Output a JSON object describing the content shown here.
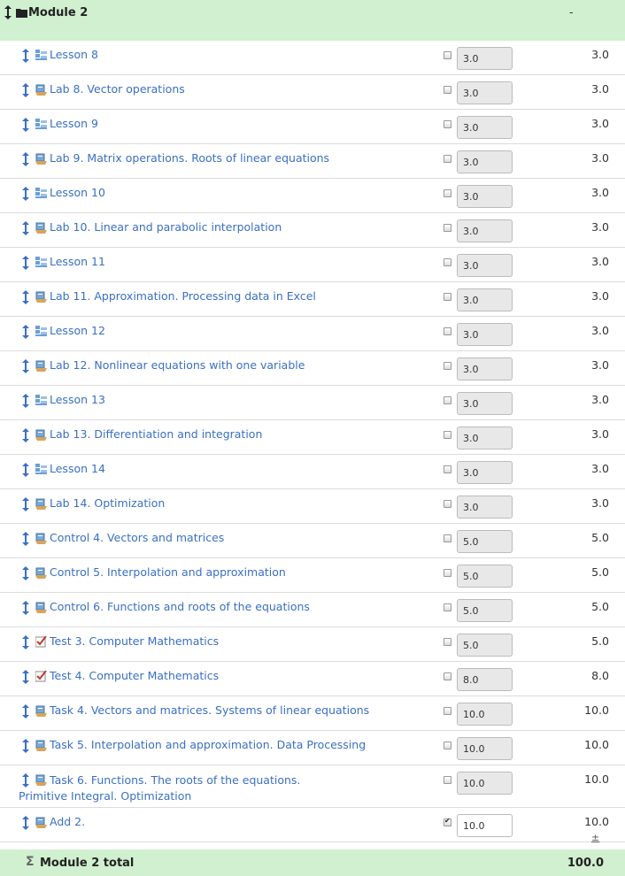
{
  "category": {
    "title": "Module 2",
    "total_value": "-"
  },
  "colors": {
    "header_bg": "#d0f0d0",
    "link": "#3a6fc4"
  },
  "items": [
    {
      "name": "Lesson 8",
      "icon": "lesson-icon",
      "weight": "3.0",
      "value": "3.0",
      "checked": false
    },
    {
      "name": "Lab 8. Vector operations",
      "icon": "assignment-icon",
      "weight": "3.0",
      "value": "3.0",
      "checked": false
    },
    {
      "name": "Lesson 9",
      "icon": "lesson-icon",
      "weight": "3.0",
      "value": "3.0",
      "checked": false
    },
    {
      "name": "Lab 9. Matrix operations. Roots of linear equations",
      "icon": "assignment-icon",
      "weight": "3.0",
      "value": "3.0",
      "checked": false
    },
    {
      "name": "Lesson 10",
      "icon": "lesson-icon",
      "weight": "3.0",
      "value": "3.0",
      "checked": false
    },
    {
      "name": "Lab 10. Linear and parabolic interpolation",
      "icon": "assignment-icon",
      "weight": "3.0",
      "value": "3.0",
      "checked": false
    },
    {
      "name": "Lesson 11",
      "icon": "lesson-icon",
      "weight": "3.0",
      "value": "3.0",
      "checked": false
    },
    {
      "name": "Lab 11. Approximation. Processing data in Excel",
      "icon": "assignment-icon",
      "weight": "3.0",
      "value": "3.0",
      "checked": false
    },
    {
      "name": "Lesson 12",
      "icon": "lesson-icon",
      "weight": "3.0",
      "value": "3.0",
      "checked": false
    },
    {
      "name": "Lab 12. Nonlinear equations with one variable",
      "icon": "assignment-icon",
      "weight": "3.0",
      "value": "3.0",
      "checked": false
    },
    {
      "name": "Lesson 13",
      "icon": "lesson-icon",
      "weight": "3.0",
      "value": "3.0",
      "checked": false
    },
    {
      "name": "Lab 13. Differentiation and integration",
      "icon": "assignment-icon",
      "weight": "3.0",
      "value": "3.0",
      "checked": false
    },
    {
      "name": "Lesson 14",
      "icon": "lesson-icon",
      "weight": "3.0",
      "value": "3.0",
      "checked": false
    },
    {
      "name": "Lab 14. Optimization",
      "icon": "assignment-icon",
      "weight": "3.0",
      "value": "3.0",
      "checked": false
    },
    {
      "name": "Control 4. Vectors and matrices",
      "icon": "assignment-icon",
      "weight": "5.0",
      "value": "5.0",
      "checked": false
    },
    {
      "name": "Control 5. Interpolation and approximation",
      "icon": "assignment-icon",
      "weight": "5.0",
      "value": "5.0",
      "checked": false
    },
    {
      "name": "Control 6. Functions and roots of the equations",
      "icon": "assignment-icon",
      "weight": "5.0",
      "value": "5.0",
      "checked": false
    },
    {
      "name": "Test 3. Computer Mathematics",
      "icon": "quiz-icon",
      "weight": "5.0",
      "value": "5.0",
      "checked": false
    },
    {
      "name": "Test 4. Computer Mathematics",
      "icon": "quiz-icon",
      "weight": "8.0",
      "value": "8.0",
      "checked": false
    },
    {
      "name": "Task 4. Vectors and matrices. Systems of linear equations",
      "icon": "assignment-icon",
      "weight": "10.0",
      "value": "10.0",
      "checked": false
    },
    {
      "name": "Task 5. Interpolation and approximation. Data Processing",
      "icon": "assignment-icon",
      "weight": "10.0",
      "value": "10.0",
      "checked": false
    },
    {
      "name": "Task 6. Functions. The roots of the equations. Primitive Integral. Optimization",
      "icon": "assignment-icon",
      "weight": "10.0",
      "value": "10.0",
      "checked": false
    },
    {
      "name": "Add 2.",
      "icon": "assignment-icon",
      "weight": "10.0",
      "value": "10.0",
      "checked": true
    }
  ],
  "plusminus": "±",
  "footer": {
    "sigma": "Σ",
    "label": "Module 2 total",
    "total": "100.0"
  }
}
